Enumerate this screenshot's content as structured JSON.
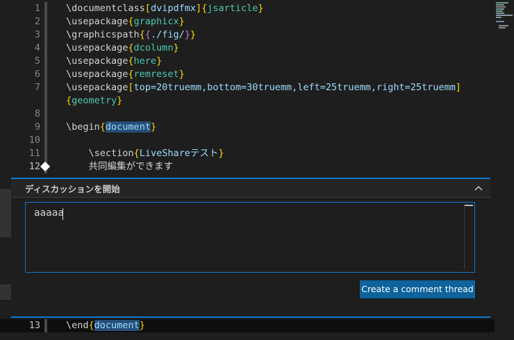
{
  "editor": {
    "lines": [
      {
        "n": "1",
        "parts": [
          {
            "t": "\\documentclass",
            "c": "kw"
          },
          {
            "t": "[",
            "c": "br"
          },
          {
            "t": "dvipdfmx",
            "c": "ar2"
          },
          {
            "t": "]",
            "c": "br"
          },
          {
            "t": "{",
            "c": "br"
          },
          {
            "t": "jsarticle",
            "c": "ar"
          },
          {
            "t": "}",
            "c": "br"
          }
        ]
      },
      {
        "n": "2",
        "parts": [
          {
            "t": "\\usepackage",
            "c": "kw"
          },
          {
            "t": "{",
            "c": "br"
          },
          {
            "t": "graphicx",
            "c": "ar"
          },
          {
            "t": "}",
            "c": "br"
          }
        ]
      },
      {
        "n": "3",
        "parts": [
          {
            "t": "\\graphicspath",
            "c": "kw"
          },
          {
            "t": "{",
            "c": "br"
          },
          {
            "t": "{",
            "c": "br2"
          },
          {
            "t": "./fig/",
            "c": "ar2"
          },
          {
            "t": "}",
            "c": "br2"
          },
          {
            "t": "}",
            "c": "br"
          }
        ]
      },
      {
        "n": "4",
        "parts": [
          {
            "t": "\\usepackage",
            "c": "kw"
          },
          {
            "t": "{",
            "c": "br"
          },
          {
            "t": "dcolumn",
            "c": "ar"
          },
          {
            "t": "}",
            "c": "br"
          }
        ]
      },
      {
        "n": "5",
        "parts": [
          {
            "t": "\\usepackage",
            "c": "kw"
          },
          {
            "t": "{",
            "c": "br"
          },
          {
            "t": "here",
            "c": "ar"
          },
          {
            "t": "}",
            "c": "br"
          }
        ]
      },
      {
        "n": "6",
        "parts": [
          {
            "t": "\\usepackage",
            "c": "kw"
          },
          {
            "t": "{",
            "c": "br"
          },
          {
            "t": "remreset",
            "c": "ar"
          },
          {
            "t": "}",
            "c": "br"
          }
        ]
      },
      {
        "n": "7",
        "parts": [
          {
            "t": "\\usepackage",
            "c": "kw"
          },
          {
            "t": "[",
            "c": "br"
          },
          {
            "t": "top=20truemm,bottom=30truemm,left=25truemm,right=25truemm",
            "c": "ar2"
          },
          {
            "t": "]",
            "c": "br"
          }
        ]
      },
      {
        "n": "",
        "parts": [
          {
            "t": "{",
            "c": "br"
          },
          {
            "t": "geometry",
            "c": "ar"
          },
          {
            "t": "}",
            "c": "br"
          }
        ]
      },
      {
        "n": "8",
        "parts": []
      },
      {
        "n": "9",
        "parts": [
          {
            "t": "\\begin",
            "c": "kw"
          },
          {
            "t": "{",
            "c": "br"
          },
          {
            "t": "document",
            "c": "ar2 hl-word"
          },
          {
            "t": "}",
            "c": "br"
          }
        ]
      },
      {
        "n": "10",
        "parts": []
      },
      {
        "n": "11",
        "parts": [
          {
            "t": "    \\section",
            "c": "kw"
          },
          {
            "t": "{",
            "c": "br"
          },
          {
            "t": "LiveShareテスト",
            "c": "ar2"
          },
          {
            "t": "}",
            "c": "br"
          }
        ]
      },
      {
        "n": "12",
        "parts": [
          {
            "t": "    共同編集ができます",
            "c": "kw"
          }
        ]
      }
    ],
    "last_line": {
      "n": "13",
      "parts": [
        {
          "t": "\\end",
          "c": "kw"
        },
        {
          "t": "{",
          "c": "br"
        },
        {
          "t": "document",
          "c": "ar2 hl-word"
        },
        {
          "t": "}",
          "c": "br"
        }
      ]
    }
  },
  "comment_widget": {
    "title": "ディスカッションを開始",
    "collapse_icon": "chevron-up-icon",
    "textbox_value": "aaaaa",
    "create_button_label": "Create a comment thread"
  },
  "colors": {
    "accent": "#0e78d4",
    "button": "#0e639c",
    "background": "#1e1e1e"
  }
}
